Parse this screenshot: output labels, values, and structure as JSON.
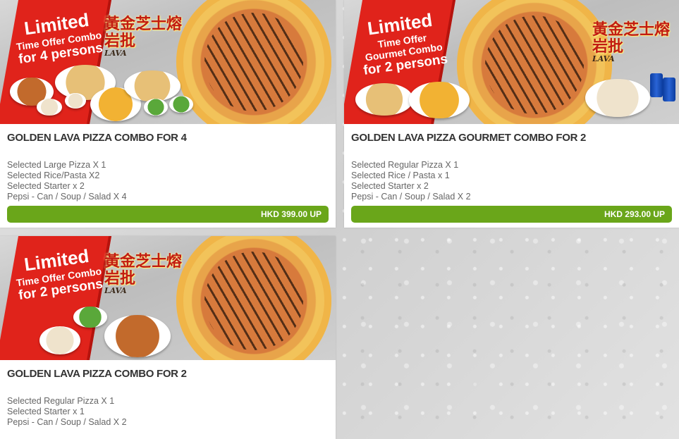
{
  "products": [
    {
      "ribbon": [
        "Limited",
        "Time Offer Combo",
        "for 4 persons"
      ],
      "cn_title": "黃金芝士熔岩批",
      "cn_sub": "LAVA",
      "title": "GOLDEN LAVA PIZZA COMBO FOR 4",
      "items": [
        "Selected Large Pizza X 1",
        "Selected Rice/Pasta X2",
        "Selected Starter x 2",
        "Pepsi - Can / Soup / Salad X 4"
      ],
      "price": "HKD 399.00 UP"
    },
    {
      "ribbon": [
        "Limited",
        "Time Offer",
        "Gourmet Combo",
        "for 2 persons"
      ],
      "cn_title": "黃金芝士熔岩批",
      "cn_sub": "LAVA",
      "title": "GOLDEN LAVA PIZZA GOURMET COMBO FOR 2",
      "items": [
        "Selected Regular Pizza X 1",
        "Selected Rice / Pasta x 1",
        "Selected Starter x 2",
        "Pepsi - Can / Soup / Salad X 2"
      ],
      "price": "HKD 293.00 UP"
    },
    {
      "ribbon": [
        "Limited",
        "Time Offer Combo",
        "for 2 persons"
      ],
      "cn_title": "黃金芝士熔岩批",
      "cn_sub": "LAVA",
      "title": "GOLDEN LAVA PIZZA COMBO FOR 2",
      "items": [
        "Selected Regular Pizza X 1",
        "Selected Starter x 1",
        "Pepsi - Can / Soup / Salad X 2"
      ]
    }
  ],
  "colors": {
    "ribbon": "#e0231b",
    "price_button": "#6aa61a",
    "title_text": "#333333",
    "item_text": "#666666"
  }
}
